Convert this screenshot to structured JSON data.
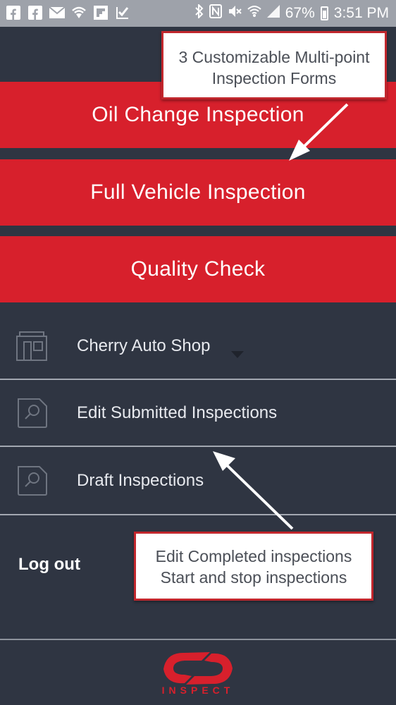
{
  "status_bar": {
    "battery": "67%",
    "time": "3:51 PM",
    "left_icons": [
      "facebook-icon",
      "facebook-icon",
      "email-icon",
      "wifi-shield-icon",
      "flipboard-icon",
      "check-icon"
    ],
    "right_icons": [
      "bluetooth-icon",
      "nfc-icon",
      "mute-icon",
      "wifi-icon",
      "signal-icon",
      "battery-icon"
    ]
  },
  "inspection_buttons": [
    {
      "label": "Oil Change Inspection"
    },
    {
      "label": "Full Vehicle Inspection"
    },
    {
      "label": "Quality Check"
    }
  ],
  "menu": {
    "shop": {
      "label": "Cherry Auto Shop",
      "icon": "shop-icon"
    },
    "edit_submitted": {
      "label": "Edit Submitted Inspections",
      "icon": "document-search-icon"
    },
    "drafts": {
      "label": "Draft Inspections",
      "icon": "document-search-icon"
    },
    "logout": {
      "label": "Log out"
    }
  },
  "callouts": {
    "top": {
      "line1": "3 Customizable Multi-point",
      "line2": "Inspection Forms"
    },
    "bottom": {
      "line1": "Edit Completed inspections",
      "line2": "Start and stop inspections"
    }
  },
  "brand": {
    "name": "INSPECT",
    "color": "#d7202c"
  },
  "colors": {
    "accent": "#d7202c",
    "background": "#2f3542",
    "status_bar": "#9ea2aa"
  }
}
